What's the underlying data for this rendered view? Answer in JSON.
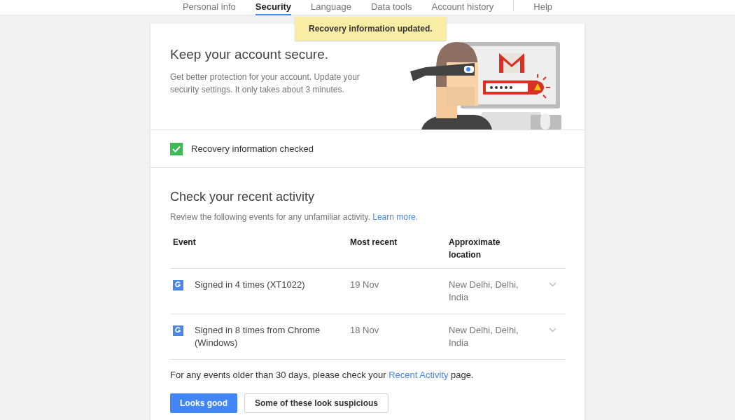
{
  "tabs": [
    {
      "label": "Personal info",
      "selected": false
    },
    {
      "label": "Security",
      "selected": true
    },
    {
      "label": "Language",
      "selected": false
    },
    {
      "label": "Data tools",
      "selected": false
    },
    {
      "label": "Account history",
      "selected": false
    },
    {
      "label": "Help",
      "selected": false
    }
  ],
  "toast": "Recovery information updated.",
  "hero": {
    "title": "Keep your account secure.",
    "text": "Get better protection for your account. Update your security settings. It only takes about 3 minutes."
  },
  "recovery": {
    "label": "Recovery information checked",
    "checked": true
  },
  "activity": {
    "title": "Check your recent activity",
    "text": "Review the following events for any unfamiliar activity.",
    "link": "Learn more.",
    "columns": [
      "Event",
      "Most recent",
      "Approximate location"
    ],
    "rows": [
      {
        "event": "Signed in 4 times (XT1022)",
        "date": "19 Nov",
        "location": "New Delhi, Delhi, India"
      },
      {
        "event": "Signed in 8 times from Chrome (Windows)",
        "date": "18 Nov",
        "location": "New Delhi, Delhi, India"
      }
    ],
    "footer_before": "For any events older than 30 days, please check your",
    "footer_link": "Recent Activity",
    "footer_after": "page.",
    "buttons": [
      {
        "label": "Looks good",
        "kind": "primary"
      },
      {
        "label": "Some of these look suspicious",
        "kind": "secondary"
      }
    ]
  }
}
